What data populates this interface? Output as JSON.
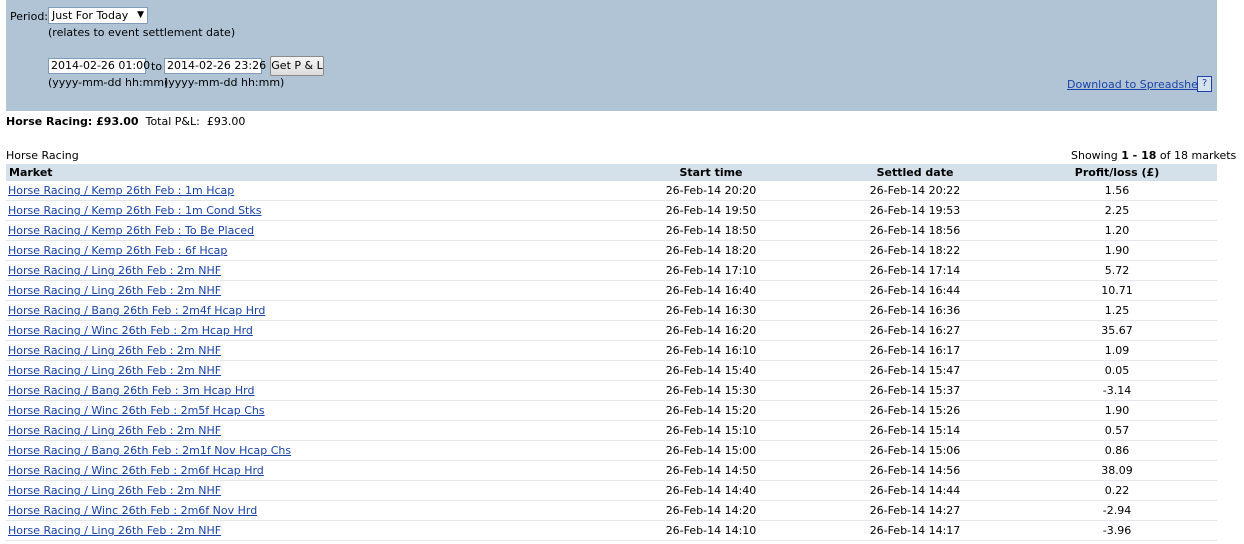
{
  "filters": {
    "period_label": "Period:",
    "period_value": "Just For Today",
    "period_note": "(relates to event settlement date)",
    "from_value": "2014-02-26 01:00",
    "to_label": "to",
    "to_value": "2014-02-26 23:26",
    "get_button": "Get P & L",
    "from_format": "(yyyy-mm-dd hh:mm)",
    "to_format": "(yyyy-mm-dd hh:mm)",
    "download_label": "Download to Spreadsheet",
    "help_label": "?"
  },
  "summary": {
    "category_label": "Horse Racing: £93.00",
    "total_label": "Total P&L:",
    "total_value": "£93.00"
  },
  "section": {
    "title": "Horse Racing",
    "showing_prefix": "Showing",
    "showing_range": "1 - 18",
    "showing_suffix": "of 18 markets"
  },
  "table": {
    "headers": {
      "market": "Market",
      "start": "Start time",
      "settled": "Settled date",
      "pl": "Profit/loss (£)"
    },
    "rows": [
      {
        "market": "Horse Racing / Kemp 26th Feb : 1m Hcap",
        "start": "26-Feb-14 20:20",
        "settled": "26-Feb-14 20:22",
        "pl": "1.56"
      },
      {
        "market": "Horse Racing / Kemp 26th Feb : 1m Cond Stks",
        "start": "26-Feb-14 19:50",
        "settled": "26-Feb-14 19:53",
        "pl": "2.25"
      },
      {
        "market": "Horse Racing / Kemp 26th Feb : To Be Placed",
        "start": "26-Feb-14 18:50",
        "settled": "26-Feb-14 18:56",
        "pl": "1.20"
      },
      {
        "market": "Horse Racing / Kemp 26th Feb : 6f Hcap",
        "start": "26-Feb-14 18:20",
        "settled": "26-Feb-14 18:22",
        "pl": "1.90"
      },
      {
        "market": "Horse Racing / Ling 26th Feb : 2m NHF",
        "start": "26-Feb-14 17:10",
        "settled": "26-Feb-14 17:14",
        "pl": "5.72"
      },
      {
        "market": "Horse Racing / Ling 26th Feb : 2m NHF",
        "start": "26-Feb-14 16:40",
        "settled": "26-Feb-14 16:44",
        "pl": "10.71"
      },
      {
        "market": "Horse Racing / Bang 26th Feb : 2m4f Hcap Hrd",
        "start": "26-Feb-14 16:30",
        "settled": "26-Feb-14 16:36",
        "pl": "1.25"
      },
      {
        "market": "Horse Racing / Winc 26th Feb : 2m Hcap Hrd",
        "start": "26-Feb-14 16:20",
        "settled": "26-Feb-14 16:27",
        "pl": "35.67"
      },
      {
        "market": "Horse Racing / Ling 26th Feb : 2m NHF",
        "start": "26-Feb-14 16:10",
        "settled": "26-Feb-14 16:17",
        "pl": "1.09"
      },
      {
        "market": "Horse Racing / Ling 26th Feb : 2m NHF",
        "start": "26-Feb-14 15:40",
        "settled": "26-Feb-14 15:47",
        "pl": "0.05"
      },
      {
        "market": "Horse Racing / Bang 26th Feb : 3m Hcap Hrd",
        "start": "26-Feb-14 15:30",
        "settled": "26-Feb-14 15:37",
        "pl": "-3.14"
      },
      {
        "market": "Horse Racing / Winc 26th Feb : 2m5f Hcap Chs",
        "start": "26-Feb-14 15:20",
        "settled": "26-Feb-14 15:26",
        "pl": "1.90"
      },
      {
        "market": "Horse Racing / Ling 26th Feb : 2m NHF",
        "start": "26-Feb-14 15:10",
        "settled": "26-Feb-14 15:14",
        "pl": "0.57"
      },
      {
        "market": "Horse Racing / Bang 26th Feb : 2m1f Nov Hcap Chs",
        "start": "26-Feb-14 15:00",
        "settled": "26-Feb-14 15:06",
        "pl": "0.86"
      },
      {
        "market": "Horse Racing / Winc 26th Feb : 2m6f Hcap Hrd",
        "start": "26-Feb-14 14:50",
        "settled": "26-Feb-14 14:56",
        "pl": "38.09"
      },
      {
        "market": "Horse Racing / Ling 26th Feb : 2m NHF",
        "start": "26-Feb-14 14:40",
        "settled": "26-Feb-14 14:44",
        "pl": "0.22"
      },
      {
        "market": "Horse Racing / Winc 26th Feb : 2m6f Nov Hrd",
        "start": "26-Feb-14 14:20",
        "settled": "26-Feb-14 14:27",
        "pl": "-2.94"
      },
      {
        "market": "Horse Racing / Ling 26th Feb : 2m NHF",
        "start": "26-Feb-14 14:10",
        "settled": "26-Feb-14 14:17",
        "pl": "-3.96"
      }
    ]
  }
}
